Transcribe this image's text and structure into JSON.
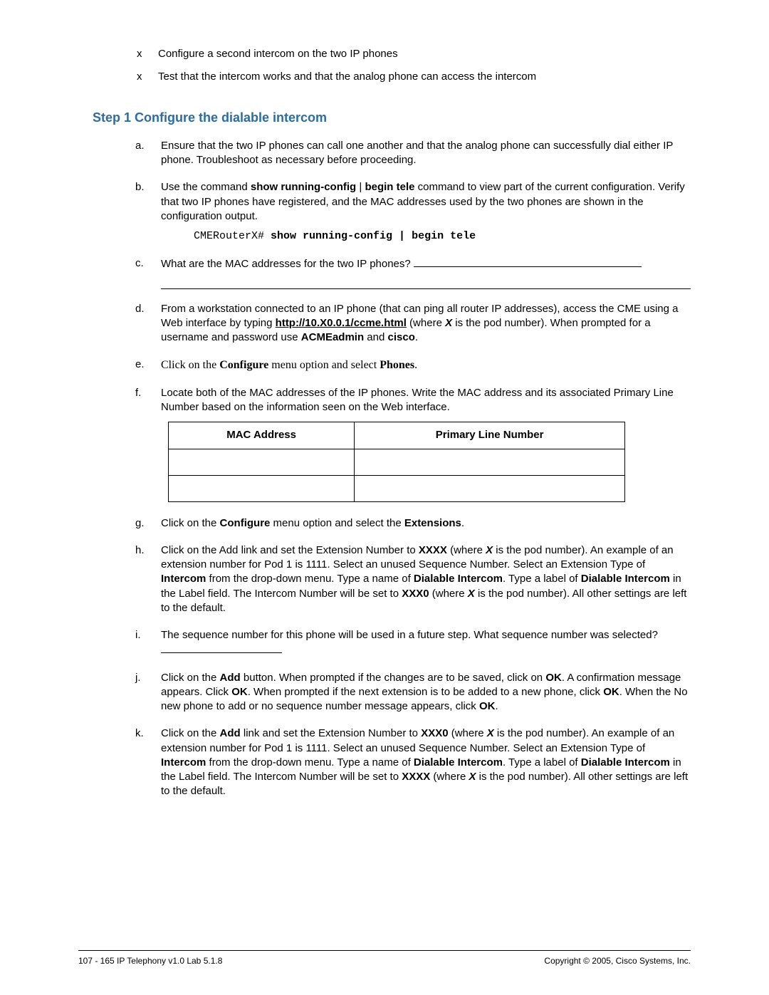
{
  "xlist": [
    "Configure a second intercom on the two IP phones",
    "Test that the intercom works and that the analog phone can access the intercom"
  ],
  "step_heading": "Step 1 Configure the dialable intercom",
  "a": {
    "text": "Ensure that the two IP phones can call one another and that the analog phone can successfully dial either IP phone. Troubleshoot as necessary before proceeding."
  },
  "b": {
    "pre": "Use the command ",
    "cmd1": "show running-config",
    "sep": " | ",
    "cmd2": "begin tele",
    "post": " command to view part of the current configuration. Verify that two IP phones have registered, and the MAC addresses used by the two phones are shown in the configuration output.",
    "mono_prompt": "CMERouterX# ",
    "mono_cmd": "show running-config | begin tele"
  },
  "c": {
    "text": "What are the MAC addresses for the two IP phones? "
  },
  "d": {
    "pre": "From a workstation connected to an IP phone (that can ping all router IP addresses), access the CME using a Web interface by typing ",
    "url": "http://10.X0.0.1/ccme.html",
    "mid1": " (where ",
    "x": "X",
    "mid2": " is the pod number). When prompted for a username and password use ",
    "user": "ACMEadmin",
    "and": " and ",
    "pass": "cisco",
    "end": "."
  },
  "e": {
    "t1": "Click on the ",
    "configure": "Configure",
    "t2": " menu option and select ",
    "phones": "Phones",
    "t3": "."
  },
  "f": {
    "text": "Locate both of the MAC addresses of the IP phones. Write the MAC address and its associated Primary Line Number based on the information seen on the Web interface."
  },
  "table": {
    "h1": "MAC Address",
    "h2": "Primary Line Number"
  },
  "g": {
    "t1": "Click on the ",
    "configure": "Configure",
    "t2": " menu option and select the ",
    "ext": "Extensions",
    "t3": "."
  },
  "h": {
    "t1": "Click on the Add link and set the Extension Number to ",
    "xxxx": "XXXX",
    "t2": " (where ",
    "x": "X",
    "t3": " is the pod number). An example of an extension number for Pod 1 is 1111. Select an unused Sequence Number. Select an Extension Type of ",
    "intercom": "Intercom",
    "t4": " from the drop-down menu. Type a name of ",
    "di": "Dialable Intercom",
    "t5": ". Type a label of ",
    "di2": "Dialable Intercom",
    "t6": " in the Label field. The Intercom Number will be set to ",
    "xxx0": "XXX0",
    "t7": " (where ",
    "x2": "X",
    "t8": " is the pod number). All other settings are left to the default."
  },
  "i": {
    "text": "The sequence number for this phone will be used in a future step. What sequence number was selected? "
  },
  "j": {
    "t1": "Click on the ",
    "add": "Add",
    "t2": " button. When prompted if the changes are to be saved, click on ",
    "ok1": "OK",
    "t3": ". A confirmation message appears. Click ",
    "ok2": "OK",
    "t4": ". When prompted if the next extension is to be added to a new phone, click ",
    "ok3": "OK",
    "t5": ". When the No new phone to add or no sequence number message appears, click ",
    "ok4": "OK",
    "t6": "."
  },
  "k": {
    "t1": "Click on the ",
    "add": "Add",
    "t2": " link and set the Extension Number to ",
    "xxx0": "XXX0",
    "t3": " (where ",
    "x": "X",
    "t4": " is the pod number). An example of an extension number for Pod 1 is 1111. Select an unused Sequence Number. Select an Extension Type of ",
    "intercom": "Intercom",
    "t5": " from the drop-down menu. Type a name of ",
    "di": "Dialable Intercom",
    "t6": ". Type a label of ",
    "di2": "Dialable Intercom",
    "t7": " in the Label field. The Intercom Number will be set to ",
    "xxxx": "XXXX",
    "t8": " (where ",
    "x2": "X",
    "t9": " is the pod number). All other settings are left to the default."
  },
  "footer": {
    "left": "107 - 165 IP Telephony v1.0   Lab 5.1.8",
    "right": "Copyright © 2005, Cisco Systems, Inc."
  }
}
